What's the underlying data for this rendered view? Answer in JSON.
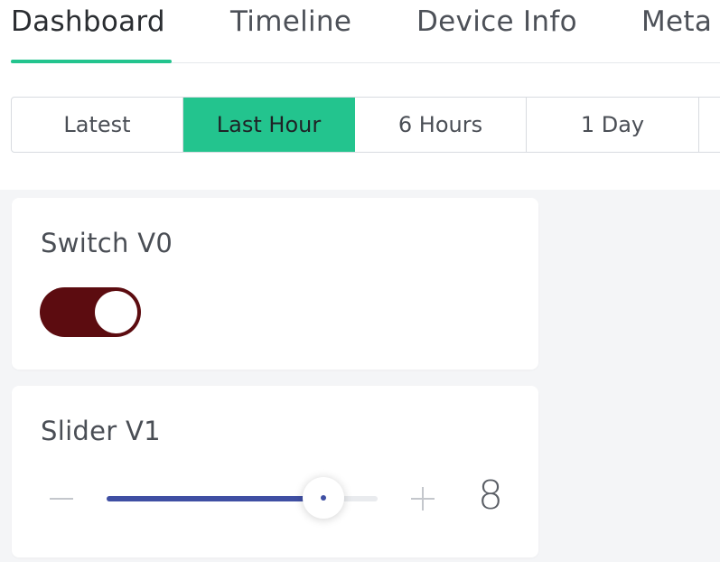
{
  "tabs": [
    {
      "label": "Dashboard",
      "active": true
    },
    {
      "label": "Timeline",
      "active": false
    },
    {
      "label": "Device Info",
      "active": false
    },
    {
      "label": "Meta",
      "active": false
    }
  ],
  "time_ranges": [
    {
      "label": "Latest",
      "active": false
    },
    {
      "label": "Last Hour",
      "active": true
    },
    {
      "label": "6 Hours",
      "active": false
    },
    {
      "label": "1 Day",
      "active": false
    }
  ],
  "widgets": {
    "switch": {
      "title": "Switch V0",
      "state": "on",
      "color": "#5c0c10"
    },
    "slider": {
      "title": "Slider V1",
      "value": "8",
      "fill_fraction": 0.8,
      "color": "#3f4fa3",
      "minus_icon": "minus-icon",
      "plus_icon": "plus-icon"
    }
  },
  "colors": {
    "accent": "#23c48e",
    "background": "#f4f5f7",
    "card": "#ffffff"
  }
}
